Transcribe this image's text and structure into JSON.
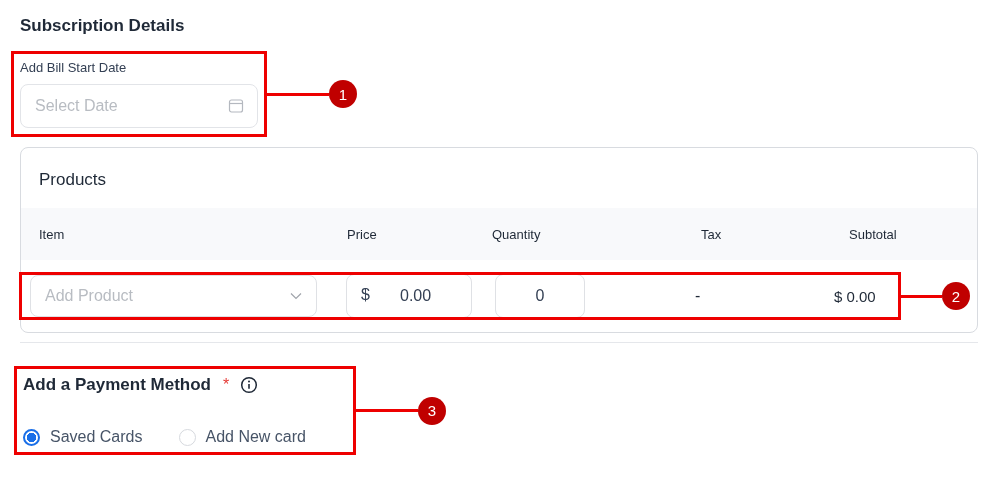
{
  "section_title": "Subscription Details",
  "bill_start": {
    "label": "Add Bill Start Date",
    "placeholder": "Select Date",
    "callout": "1"
  },
  "products": {
    "title": "Products",
    "columns": [
      "Item",
      "Price",
      "Quantity",
      "Tax",
      "Subtotal"
    ],
    "rows": [
      {
        "item_placeholder": "Add Product",
        "currency": "$",
        "price": "0.00",
        "quantity": "0",
        "tax": "-",
        "subtotal": "$ 0.00",
        "callout": "2"
      }
    ]
  },
  "payment": {
    "title": "Add a Payment Method",
    "required_mark": "*",
    "callout": "3",
    "options": [
      {
        "label": "Saved Cards",
        "selected": true
      },
      {
        "label": "Add New card",
        "selected": false
      }
    ]
  }
}
